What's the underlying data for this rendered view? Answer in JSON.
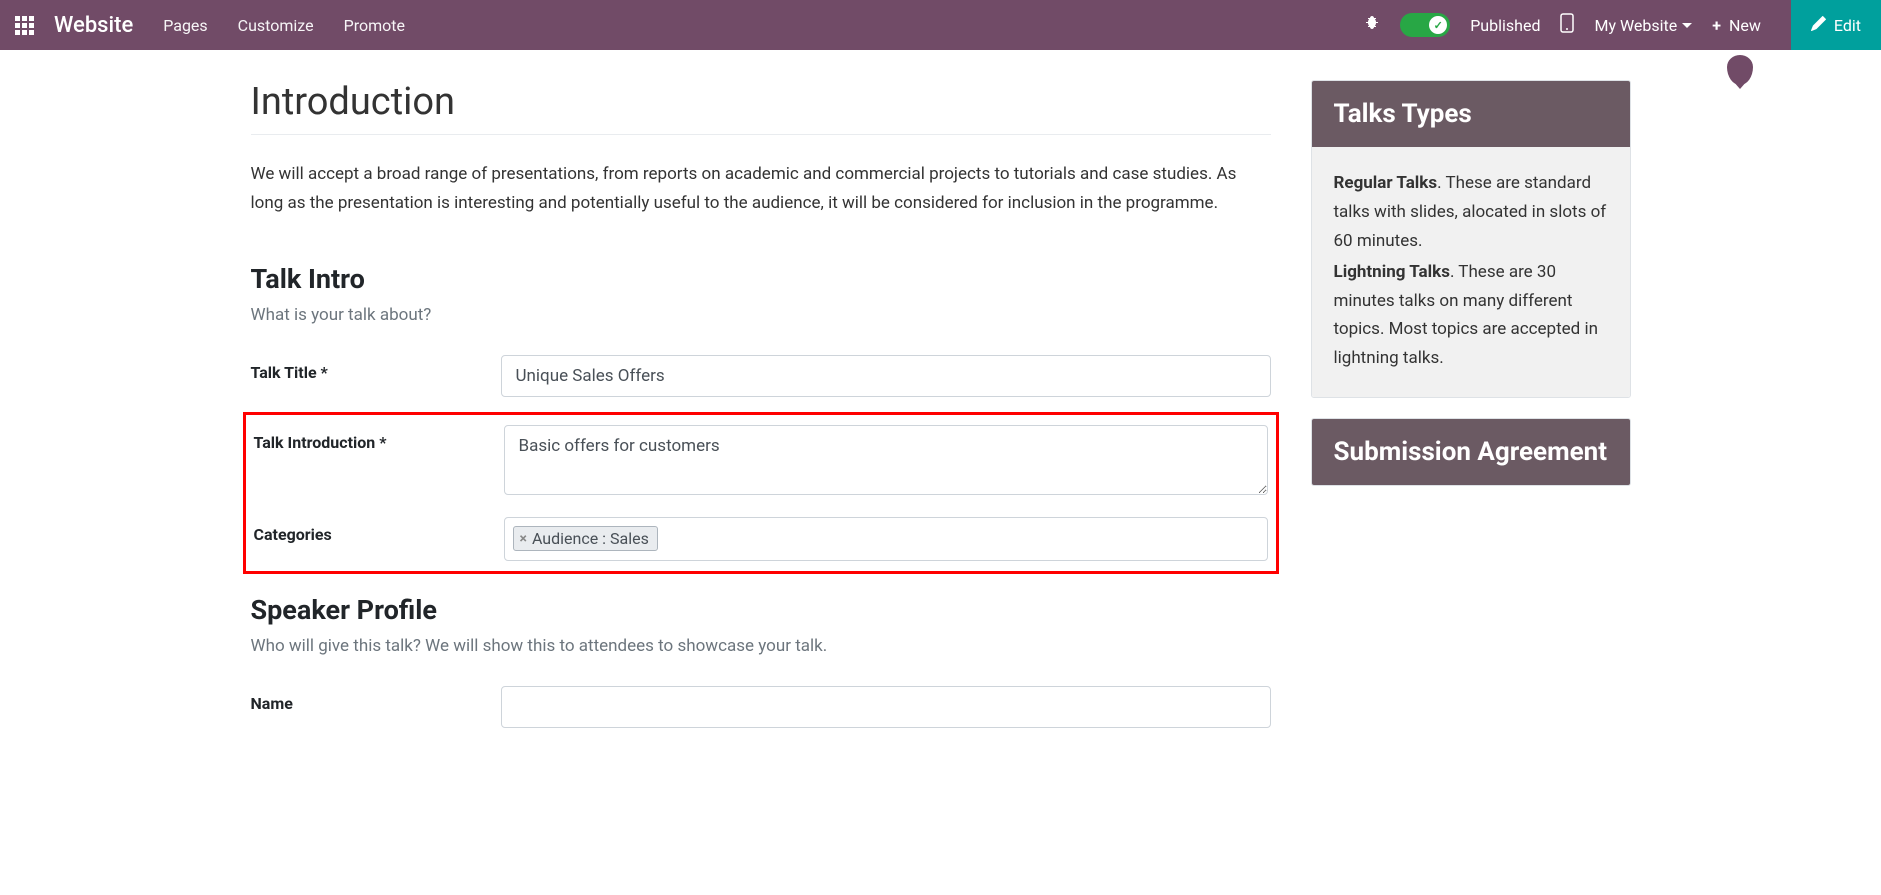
{
  "navbar": {
    "brand": "Website",
    "links": {
      "pages": "Pages",
      "customize": "Customize",
      "promote": "Promote"
    },
    "published": "Published",
    "my_website": "My Website",
    "new": "New",
    "edit": "Edit"
  },
  "page": {
    "title": "Introduction",
    "intro": "We will accept a broad range of presentations, from reports on academic and commercial projects to tutorials and case studies. As long as the presentation is interesting and potentially useful to the audience, it will be considered for inclusion in the programme."
  },
  "talk_intro": {
    "title": "Talk Intro",
    "subtitle": "What is your talk about?",
    "talk_title_label": "Talk Title *",
    "talk_title_value": "Unique Sales Offers",
    "talk_intro_label": "Talk Introduction *",
    "talk_intro_value": "Basic offers for customers",
    "categories_label": "Categories",
    "tag_value": "Audience : Sales"
  },
  "speaker": {
    "title": "Speaker Profile",
    "subtitle": "Who will give this talk? We will show this to attendees to showcase your talk.",
    "name_label": "Name"
  },
  "sidebar": {
    "talks_types": {
      "header": "Talks Types",
      "regular_label": "Regular Talks",
      "regular_text": ". These are standard talks with slides, alocated in slots of 60 minutes.",
      "lightning_label": "Lightning Talks",
      "lightning_text": ". These are 30 minutes talks on many different topics. Most topics are accepted in lightning talks."
    },
    "submission": {
      "header": "Submission Agreement"
    }
  }
}
